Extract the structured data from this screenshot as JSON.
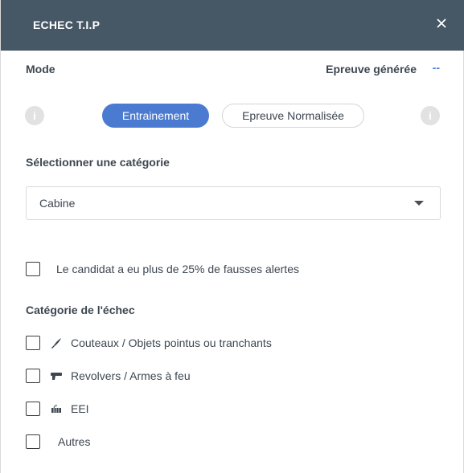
{
  "header": {
    "title": "ECHEC T.I.P",
    "close_icon": "close-icon"
  },
  "mode": {
    "label": "Mode",
    "generated_label": "Epreuve générée",
    "generated_value": "--",
    "info_icon": "i",
    "options": [
      {
        "label": "Entrainement",
        "selected": true
      },
      {
        "label": "Epreuve Normalisée",
        "selected": false
      }
    ]
  },
  "category": {
    "label": "Sélectionner une catégorie",
    "selected_value": "Cabine",
    "caret_icon": "caret-down-icon"
  },
  "false_alerts": {
    "label": "Le candidat a eu plus de 25% de fausses alertes",
    "checked": false
  },
  "failure_category": {
    "label": "Catégorie de l'échec",
    "items": [
      {
        "label": "Couteaux / Objets pointus ou tranchants",
        "icon": "knife-icon",
        "checked": false
      },
      {
        "label": "Revolvers / Armes à feu",
        "icon": "gun-icon",
        "checked": false
      },
      {
        "label": "EEI",
        "icon": "explosive-device-icon",
        "checked": false
      },
      {
        "label": "Autres",
        "icon": "",
        "checked": false
      }
    ]
  },
  "colors": {
    "header_bg": "#465766",
    "accent": "#4a7bd1",
    "text": "#3d4650"
  }
}
